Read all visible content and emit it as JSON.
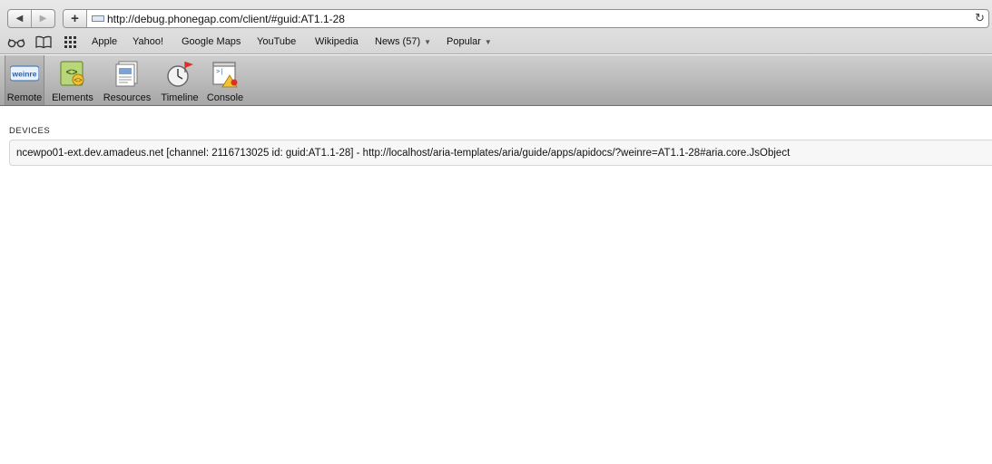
{
  "browser": {
    "nav": {
      "back_icon": "back-arrow-icon",
      "forward_icon": "forward-arrow-icon"
    },
    "add_label": "+",
    "url": "http://debug.phonegap.com/client/#guid:AT1.1-28",
    "reload_icon": "reload-icon",
    "bookmarks_bar": {
      "items": [
        {
          "label": "Apple"
        },
        {
          "label": "Yahoo!"
        },
        {
          "label": "Google Maps"
        },
        {
          "label": "YouTube"
        },
        {
          "label": "Wikipedia"
        },
        {
          "label": "News (57)"
        },
        {
          "label": "Popular"
        }
      ]
    }
  },
  "toolbar": {
    "items": [
      {
        "label": "Remote",
        "icon": "weinre-logo-icon",
        "logo_text": "weinre",
        "selected": true
      },
      {
        "label": "Elements",
        "icon": "elements-icon"
      },
      {
        "label": "Resources",
        "icon": "resources-icon"
      },
      {
        "label": "Timeline",
        "icon": "timeline-icon"
      },
      {
        "label": "Console",
        "icon": "console-icon"
      }
    ]
  },
  "devices": {
    "title": "DEVICES",
    "items": [
      {
        "text": "ncewpo01-ext.dev.amadeus.net [channel: 2116713025 id: guid:AT1.1-28] - http://localhost/aria-templates/aria/guide/apps/apidocs/?weinre=AT1.1-28#aria.core.JsObject"
      }
    ]
  }
}
